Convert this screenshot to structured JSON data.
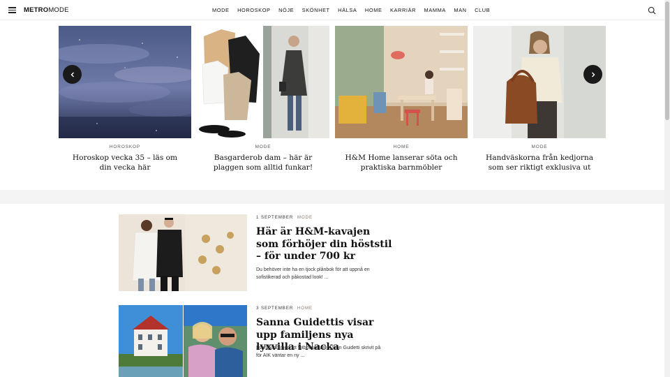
{
  "header": {
    "logo_bold": "METRO",
    "logo_light": "MODE",
    "nav": [
      "MODE",
      "HOROSKOP",
      "NÖJE",
      "SKÖNHET",
      "HÄLSA",
      "HOME",
      "KARRIÄR",
      "MAMMA",
      "MAN",
      "CLUB"
    ]
  },
  "carousel": {
    "cards": [
      {
        "category": "HOROSKOP",
        "title": "Horoskop vecka 35 – läs om din vecka här"
      },
      {
        "category": "MODE",
        "title": "Basgarderob dam – här är plaggen som alltid funkar!"
      },
      {
        "category": "HOME",
        "title": "H&M Home lanserar söta och praktiska barnmöbler"
      },
      {
        "category": "MODE",
        "title": "Handväskorna från kedjorna som ser riktigt exklusiva ut"
      }
    ]
  },
  "articles": [
    {
      "date": "1 SEPTEMBER",
      "tag": "MODE",
      "headline": "Här är H&M-kavajen som förhöjer din höststil – för under 700 kr",
      "description": "Du behöver inte ha en tjock plånbok för att uppnå en sofistikerad och påkostad look! ..."
    },
    {
      "date": "3 SEPTEMBER",
      "tag": "HOME",
      "headline": "Sanna Guidettis visar upp familjens nya lyxvilla i Nacka",
      "description": "I samband med att fotbollspelaren John Guidetti skrivit på för AIK väntar en ny ..."
    }
  ],
  "icons": {
    "menu": "hamburger-menu-icon",
    "search": "search-icon",
    "prev": "chevron-left-icon",
    "next": "chevron-right-icon"
  }
}
